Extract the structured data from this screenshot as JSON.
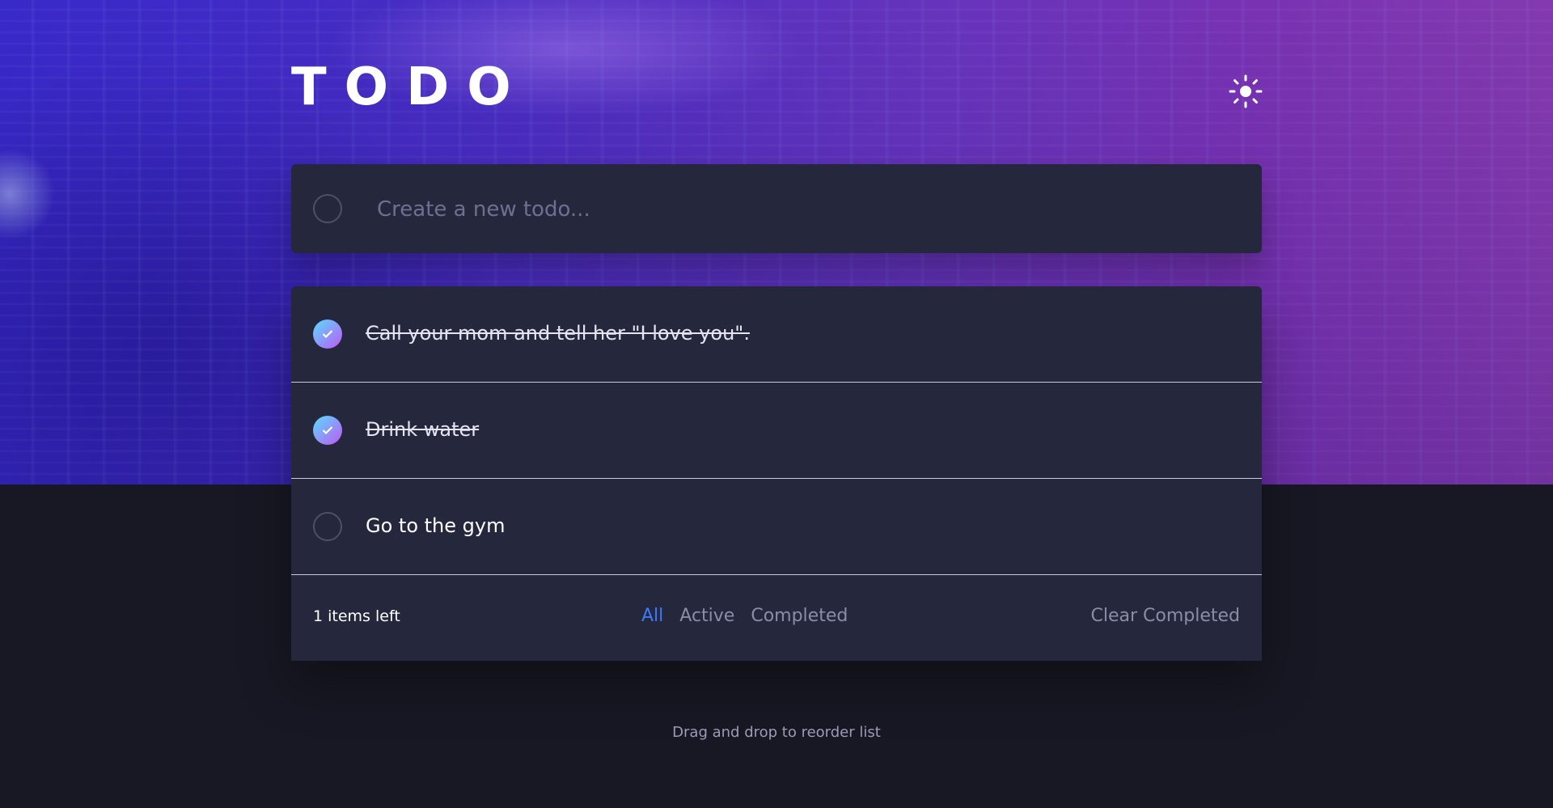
{
  "app": {
    "title": "TODO",
    "theme_toggle_icon": "sun-icon"
  },
  "new_todo": {
    "placeholder": "Create a new todo...",
    "value": ""
  },
  "todos": [
    {
      "text": "Call your mom and tell her \"I love you\".",
      "completed": true
    },
    {
      "text": "Drink water",
      "completed": true
    },
    {
      "text": "Go to the gym",
      "completed": false
    }
  ],
  "footer": {
    "items_left": "1 items left",
    "filters": [
      {
        "label": "All",
        "active": true
      },
      {
        "label": "Active",
        "active": false
      },
      {
        "label": "Completed",
        "active": false
      }
    ],
    "clear_completed": "Clear Completed"
  },
  "hint": "Drag and drop to reorder list",
  "colors": {
    "accent": "#3a7cfd",
    "check_gradient_start": "#57ddff",
    "check_gradient_end": "#c058f3",
    "card": "#25273c",
    "background": "#181824"
  }
}
